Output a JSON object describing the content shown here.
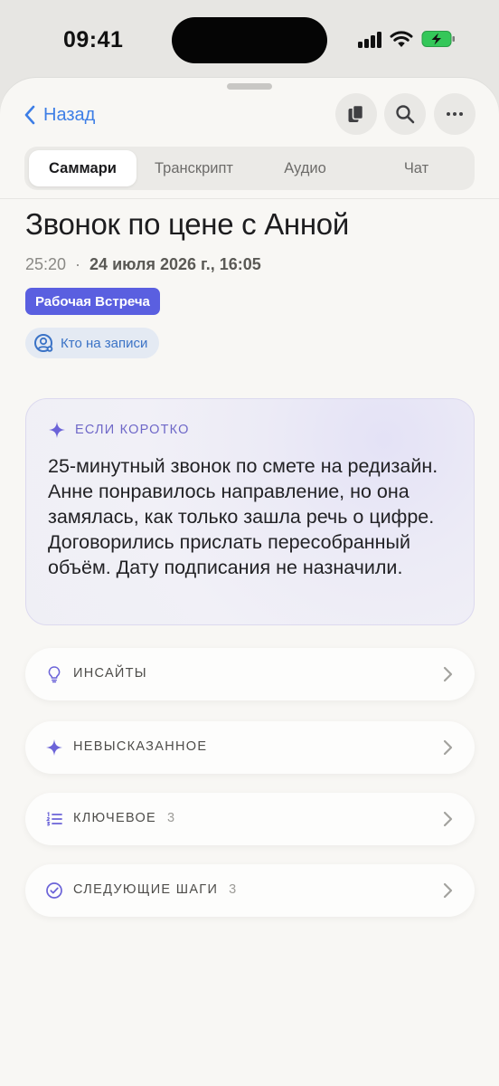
{
  "status": {
    "time": "09:41"
  },
  "nav": {
    "back_label": "Назад"
  },
  "tabs": [
    {
      "label": "Саммари",
      "active": true
    },
    {
      "label": "Транскрипт",
      "active": false
    },
    {
      "label": "Аудио",
      "active": false
    },
    {
      "label": "Чат",
      "active": false
    }
  ],
  "meeting": {
    "title": "Звонок по цене с Анной",
    "duration": "25:20",
    "separator": "·",
    "date": "24 июля 2026 г., 16:05",
    "tag": "Рабочая Встреча",
    "who_label": "Кто на записи"
  },
  "summary": {
    "heading": "ЕСЛИ КОРОТКО",
    "text": "25-минутный звонок по смете на редизайн. Анне понравилось направление, но она замялась, как только зашла речь о цифре. Договорились прислать пересобранный объём. Дату подписания не назначили."
  },
  "sections": [
    {
      "label": "ИНСАЙТЫ",
      "count": "",
      "icon": "lightbulb-icon"
    },
    {
      "label": "НЕВЫСКАЗАННОЕ",
      "count": "",
      "icon": "sparkle-icon"
    },
    {
      "label": "КЛЮЧЕВОЕ",
      "count": "3",
      "icon": "numbered-list-icon"
    },
    {
      "label": "СЛЕДУЮЩИЕ ШАГИ",
      "count": "3",
      "icon": "check-circle-icon"
    }
  ],
  "colors": {
    "accent_blue": "#3d7ee6",
    "tag_purple": "#5a5fe0",
    "summary_purple": "#6f68c8"
  }
}
